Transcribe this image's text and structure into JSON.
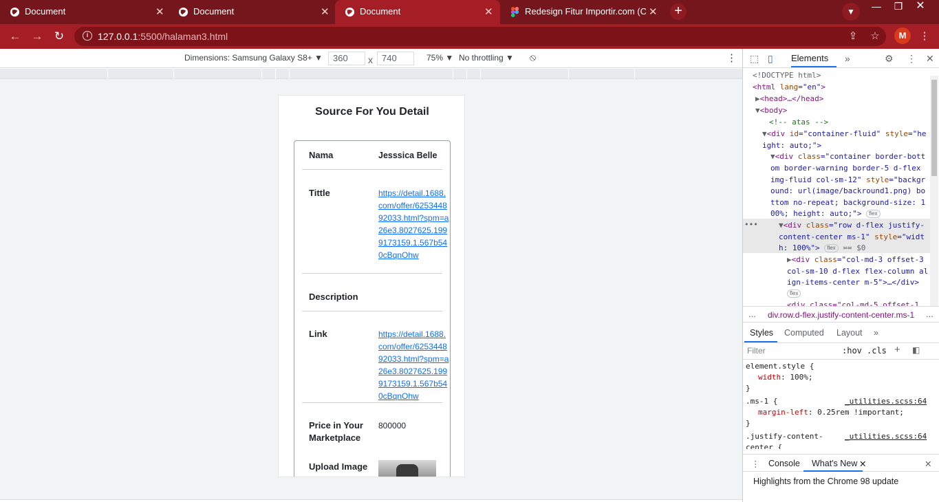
{
  "browser": {
    "tabs": [
      {
        "title": "Document",
        "active": false
      },
      {
        "title": "Document",
        "active": false
      },
      {
        "title": "Document",
        "active": true
      },
      {
        "title": "Redesign Fitur Importir.com (Cop",
        "active": false
      }
    ],
    "new_tab": "+",
    "url_host": "127.0.0.1",
    "url_rest": ":5500/halaman3.html",
    "profile_initial": "M"
  },
  "device_toolbar": {
    "dimensions_label": "Dimensions: Samsung Galaxy S8+",
    "width": "360",
    "height": "740",
    "times": "x",
    "zoom": "75%",
    "throttling": "No throttling"
  },
  "page": {
    "title": "Source For You Detail",
    "fields": {
      "nama_label": "Nama",
      "nama_value": "Jesssica Belle",
      "tittle_label": "Tittle",
      "tittle_value": "https://detail.1688.com/offer/625344892033.html?spm=a26e3.8027625.1999173159.1.567b540cBqnOhw",
      "description_label": "Description",
      "link_label": "Link",
      "link_value": "https://detail.1688.com/offer/625344892033.html?spm=a26e3.8027625.1999173159.1.567b540cBqnOhw",
      "price_label": "Price in Your Marketplace",
      "price_value": "800000",
      "upload_label": "Upload Image"
    }
  },
  "devtools": {
    "elements_tab": "Elements",
    "more": "»",
    "dom_lines": {
      "l1": "<!DOCTYPE html>",
      "l2a": "<html ",
      "l2b": "lang",
      "l2c": "=\"en\"",
      "l2d": ">",
      "l3": "<head>…</head>",
      "l4": "<body>",
      "l5": "<!-- atas -->",
      "l6a": "<div ",
      "l6b": "id",
      "l6c": "=\"container-fluid\" ",
      "l6d": "style",
      "l6e": "=\"he",
      "l7": "ight: auto;\">",
      "l8a": "<div ",
      "l8b": "class",
      "l8c": "=\"container border-bott",
      "l9": "om border-warning border-5 d-flex",
      "l10a": "img-fluid col-sm-12\" ",
      "l10b": "style",
      "l10c": "=\"backgr",
      "l11": "ound: url(image/backround1.png) bo",
      "l12": "ttom no-repeat; background-size: 1",
      "l13": "00%; height: auto;\">",
      "l14a": "<div ",
      "l14b": "class",
      "l14c": "=\"row d-flex justify-",
      "l15a": "content-center ms-1\" ",
      "l15b": "style",
      "l15c": "=\"widt",
      "l16": "h: 100%\">",
      "l16b": "== $0",
      "l17a": "<div ",
      "l17b": "class",
      "l17c": "=\"col-md-3 offset-3",
      "l18": "col-sm-10 d-flex flex-column al",
      "l19": "ign-items-center m-5\">…</div>",
      "l20": "<div class=\"col-md-5 offset-1",
      "flex": "flex"
    },
    "breadcrumb": "div.row.d-flex.justify-content-center.ms-1",
    "breadcrumb_more": "...",
    "styles_tabs": [
      "Styles",
      "Computed",
      "Layout"
    ],
    "filter_placeholder": "Filter",
    "hov": ":hov",
    "cls": ".cls",
    "styles_lines": {
      "s1": "element.style {",
      "s2a": "width",
      "s2b": ": 100%;",
      "s3": "}",
      "s4": ".ms-1 {",
      "s4src": "_utilities.scss:64",
      "s5a": "margin-left",
      "s5b": ": 0.25rem !important;",
      "s6": "}",
      "s7": ".justify-content-",
      "s7src": "_utilities.scss:64",
      "s8": "center {"
    },
    "drawer_tabs": [
      "Console",
      "What's New"
    ],
    "whats_new": "Highlights from the Chrome 98 update"
  }
}
